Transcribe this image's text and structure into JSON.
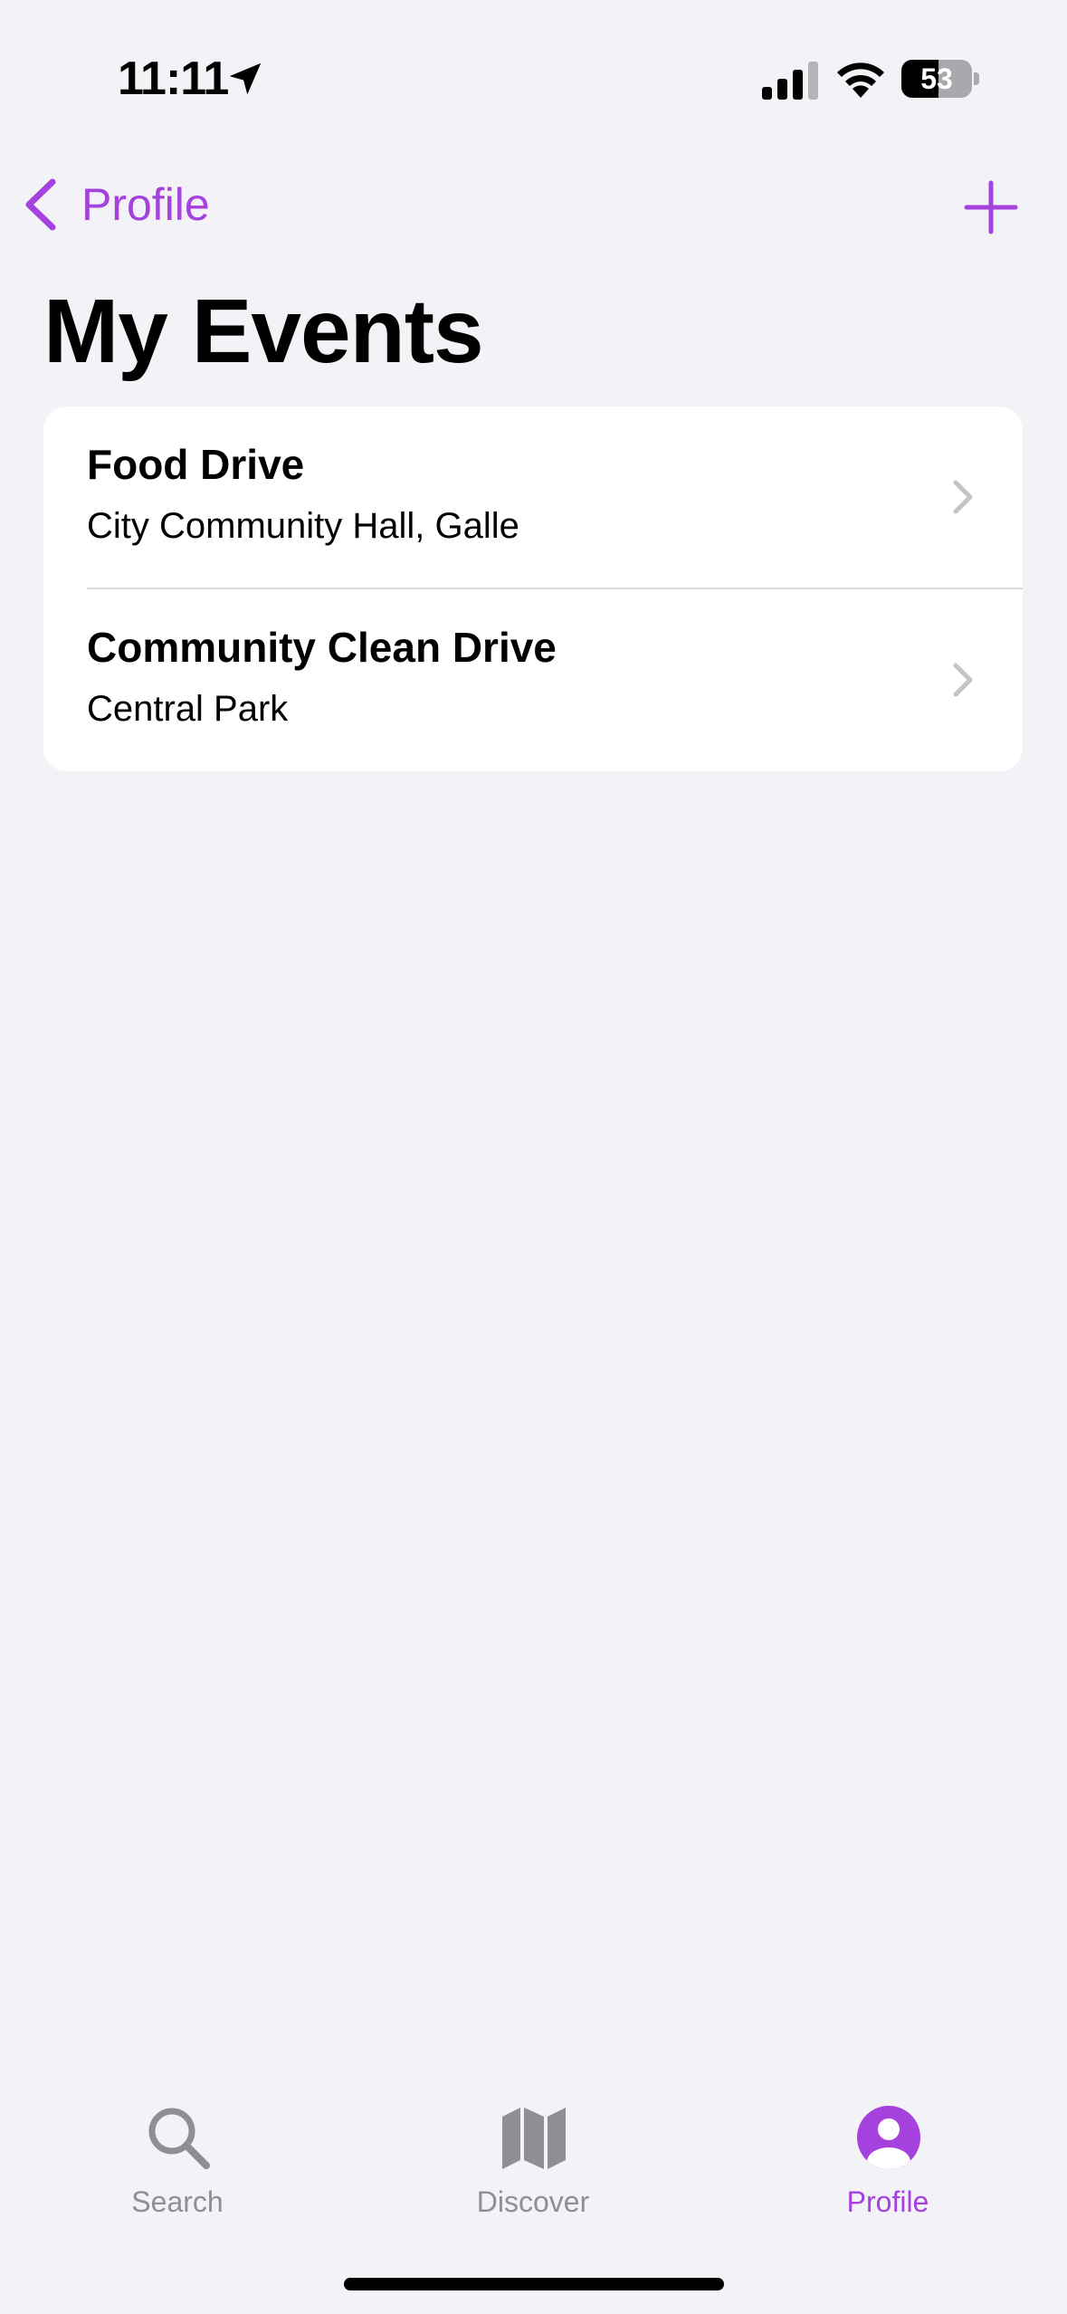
{
  "status_bar": {
    "time": "11:11",
    "battery_level": "53",
    "battery_fraction": 0.53,
    "icons": [
      "location-arrow-icon",
      "cellular-signal-icon",
      "wifi-icon",
      "battery-icon"
    ]
  },
  "nav": {
    "back_label": "Profile",
    "back_icon": "chevron-left-icon",
    "add_icon": "plus-icon"
  },
  "page": {
    "title": "My Events"
  },
  "events": [
    {
      "title": "Food Drive",
      "location": "City Community Hall, Galle"
    },
    {
      "title": "Community Clean Drive",
      "location": "Central Park"
    }
  ],
  "tab_bar": {
    "tabs": [
      {
        "label": "Search",
        "icon": "magnifying-glass-icon",
        "active": false
      },
      {
        "label": "Discover",
        "icon": "map-icon",
        "active": false
      },
      {
        "label": "Profile",
        "icon": "person-circle-icon",
        "active": true
      }
    ]
  },
  "colors": {
    "accent": "#a541dd",
    "background": "#f2f2f7",
    "card": "#ffffff",
    "inactive_tab": "#8e8e93",
    "chevron": "#c4c4c7"
  }
}
